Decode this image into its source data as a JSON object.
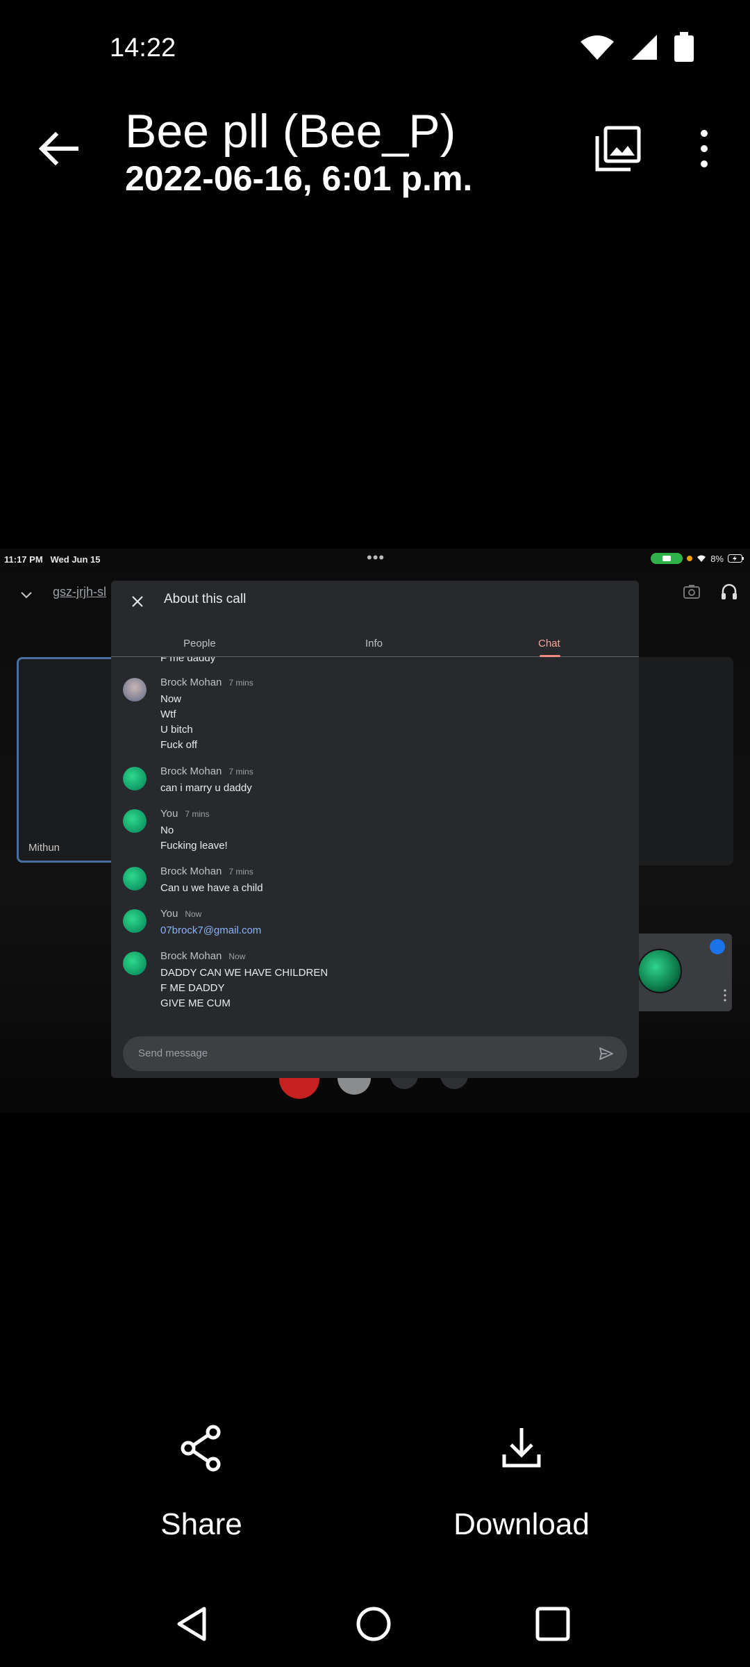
{
  "status_bar": {
    "time": "14:22",
    "icons": [
      "wifi-icon",
      "cell-signal-icon",
      "battery-icon"
    ]
  },
  "app_bar": {
    "title": "Bee pll (Bee_P)",
    "subtitle": "2022-06-16, 6:01 p.m.",
    "back_icon": "arrow-back-icon",
    "gallery_icon": "gallery-icon",
    "more_icon": "more-vert-icon"
  },
  "screenshot": {
    "status": {
      "time": "11:17 PM",
      "date": "Wed Jun 15",
      "battery": "8%"
    },
    "meeting_code": "gsz-jrjh-sl",
    "left_tile_name": "Mithun",
    "dialog": {
      "title": "About this call",
      "tabs": [
        "People",
        "Info",
        "Chat"
      ],
      "active_tab": "Chat",
      "cut_off_line": "F me daddy",
      "messages": [
        {
          "sender": "Brock Mohan",
          "time": "7 mins",
          "lines": [
            "Now",
            "Wtf",
            "U bitch",
            "Fuck off"
          ]
        },
        {
          "sender": "Brock Mohan",
          "time": "7 mins",
          "lines": [
            "can i marry u daddy"
          ]
        },
        {
          "sender": "You",
          "time": "7 mins",
          "lines": [
            "No",
            "Fucking leave!"
          ]
        },
        {
          "sender": "Brock Mohan",
          "time": "7 mins",
          "lines": [
            "Can u we have a child"
          ]
        },
        {
          "sender": "You",
          "time": "Now",
          "lines": [
            "07brock7@gmail.com"
          ]
        },
        {
          "sender": "Brock Mohan",
          "time": "Now",
          "lines": [
            "DADDY CAN WE HAVE CHILDREN",
            "F ME DADDY",
            "GIVE ME CUM"
          ]
        }
      ],
      "send_placeholder": "Send message"
    }
  },
  "actions": {
    "share": "Share",
    "download": "Download"
  },
  "nav": [
    "back",
    "home",
    "recents"
  ]
}
